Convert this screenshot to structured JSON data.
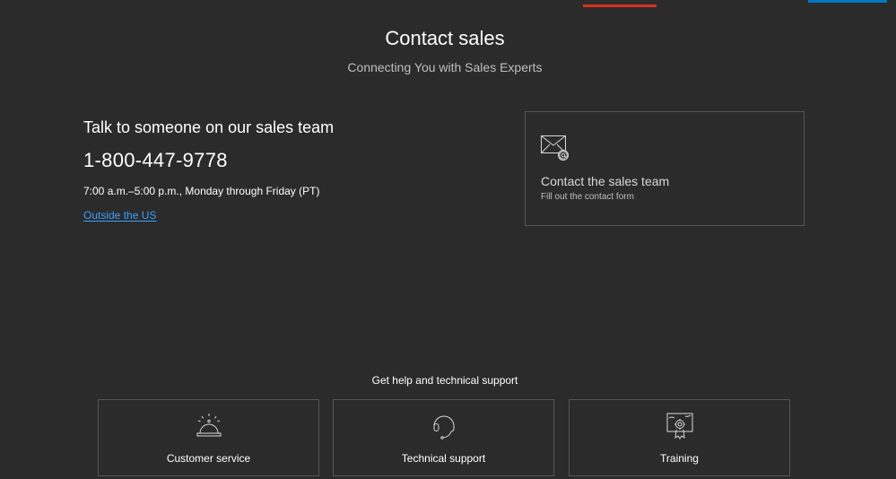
{
  "header": {
    "title": "Contact sales",
    "subtitle": "Connecting You with Sales Experts"
  },
  "sales": {
    "heading": "Talk to someone on our sales team",
    "phone": "1-800-447-9778",
    "hours": "7:00 a.m.–5:00 p.m., Monday through Friday (PT)",
    "outside_link": "Outside the US"
  },
  "contact_card": {
    "icon": "envelope-at-icon",
    "title": "Contact the sales team",
    "subtitle": "Fill out the contact form"
  },
  "support": {
    "heading": "Get help and technical support",
    "cards": [
      {
        "icon": "service-bell-icon",
        "label": "Customer service"
      },
      {
        "icon": "headset-icon",
        "label": "Technical support"
      },
      {
        "icon": "certificate-gear-icon",
        "label": "Training"
      }
    ]
  },
  "colors": {
    "background": "#2b2b2b",
    "link": "#3aa0ff",
    "accent_orange": "#d83020",
    "accent_blue": "#0079c1",
    "border": "#555555"
  }
}
